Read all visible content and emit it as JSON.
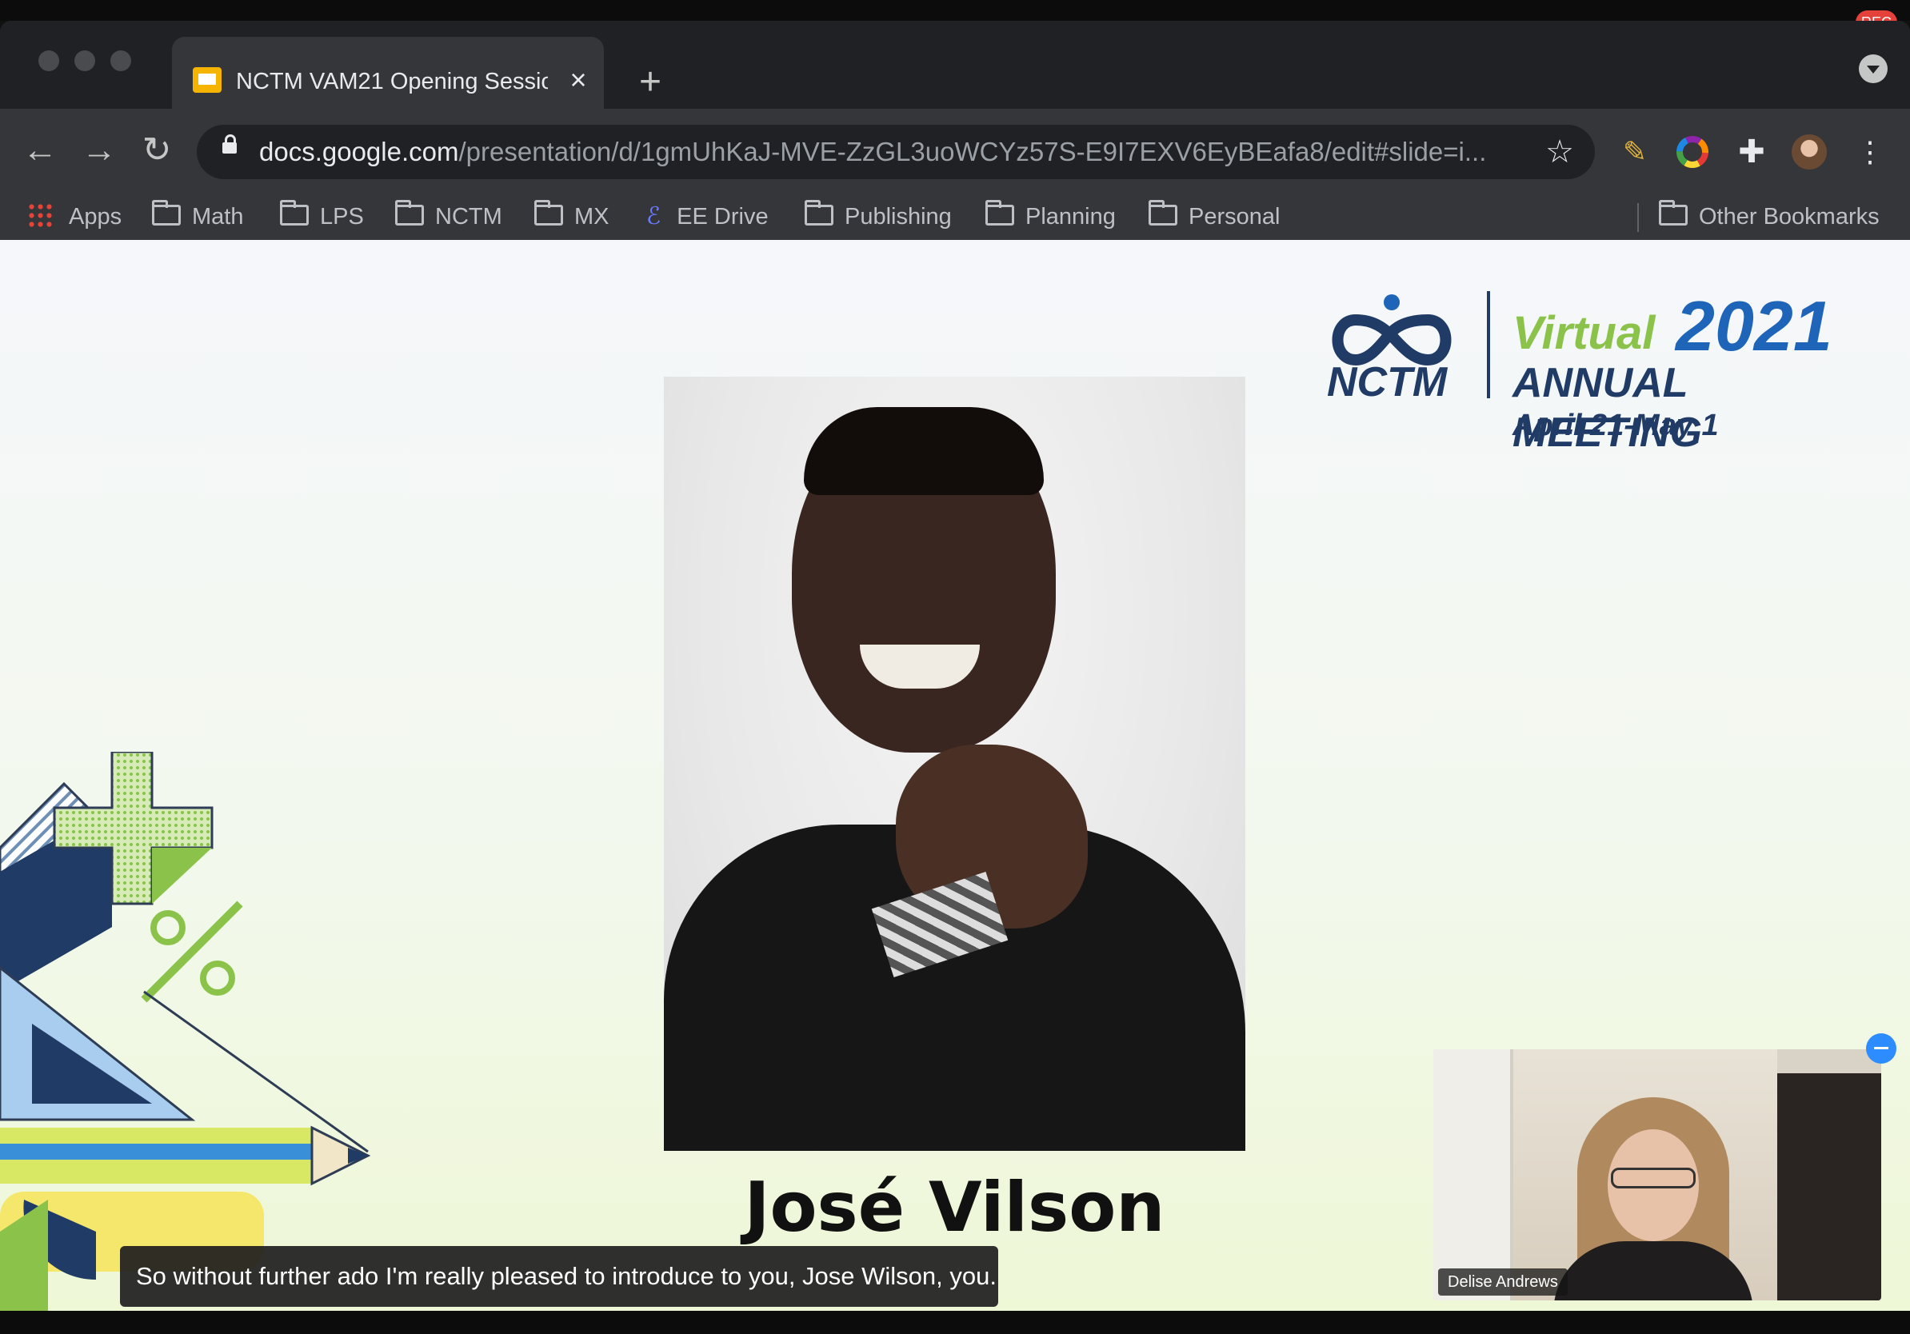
{
  "recording": {
    "label": "REC"
  },
  "browser": {
    "tab": {
      "title": "NCTM VAM21 Opening Sessio",
      "close": "×"
    },
    "new_tab": "+",
    "address": {
      "host": "docs.google.com",
      "path": "/presentation/d/1gmUhKaJ-MVE-ZzGL3uoWCYz57S-E9I7EXV6EyBEafa8/edit#slide=i..."
    },
    "bookmarks": [
      {
        "label": "Apps",
        "icon": "apps-grid-icon"
      },
      {
        "label": "Math",
        "icon": "folder-icon"
      },
      {
        "label": "LPS",
        "icon": "folder-icon"
      },
      {
        "label": "NCTM",
        "icon": "folder-icon"
      },
      {
        "label": "MX",
        "icon": "folder-icon"
      },
      {
        "label": "EE Drive",
        "icon": "ee-icon"
      },
      {
        "label": "Publishing",
        "icon": "folder-icon"
      },
      {
        "label": "Planning",
        "icon": "folder-icon"
      },
      {
        "label": "Personal",
        "icon": "folder-icon"
      }
    ],
    "other_bookmarks": "Other Bookmarks"
  },
  "slide": {
    "logo": {
      "org": "NCTM",
      "virtual": "Virtual",
      "year": "2021",
      "event": "ANNUAL MEETING",
      "dates": "April 21-May 1"
    },
    "speaker_name": "José Vilson"
  },
  "caption": {
    "text": "So without further ado I'm really pleased to introduce to you, Jose Wilson, you."
  },
  "participant": {
    "name": "Delise Andrews"
  },
  "colors": {
    "nctm_navy": "#1f3b66",
    "nctm_green": "#8bc34a",
    "nctm_blue": "#1e64b8",
    "rec_red": "#e5413b",
    "zoom_blue": "#2d8cff"
  }
}
